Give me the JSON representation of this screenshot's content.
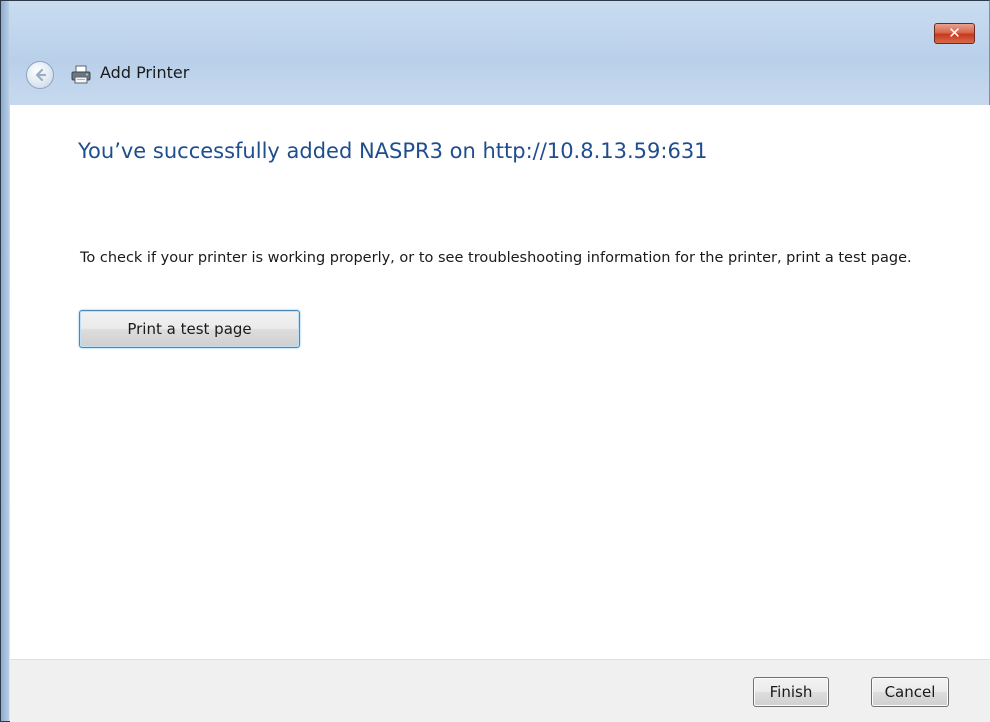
{
  "window": {
    "title": "Add Printer",
    "close_glyph": "✕",
    "back_icon": "back-arrow-icon",
    "app_icon": "printer-icon"
  },
  "main": {
    "heading": "You’ve successfully added NASPR3 on http://10.8.13.59:631",
    "description": "To check if your printer is working properly, or to see troubleshooting information for the printer, print a test page.",
    "test_page_button": "Print a test page"
  },
  "footer": {
    "finish_label": "Finish",
    "cancel_label": "Cancel"
  },
  "colors": {
    "heading": "#1e4e8f",
    "close_button": "#c8381c",
    "focus_border": "#4d87b5"
  }
}
